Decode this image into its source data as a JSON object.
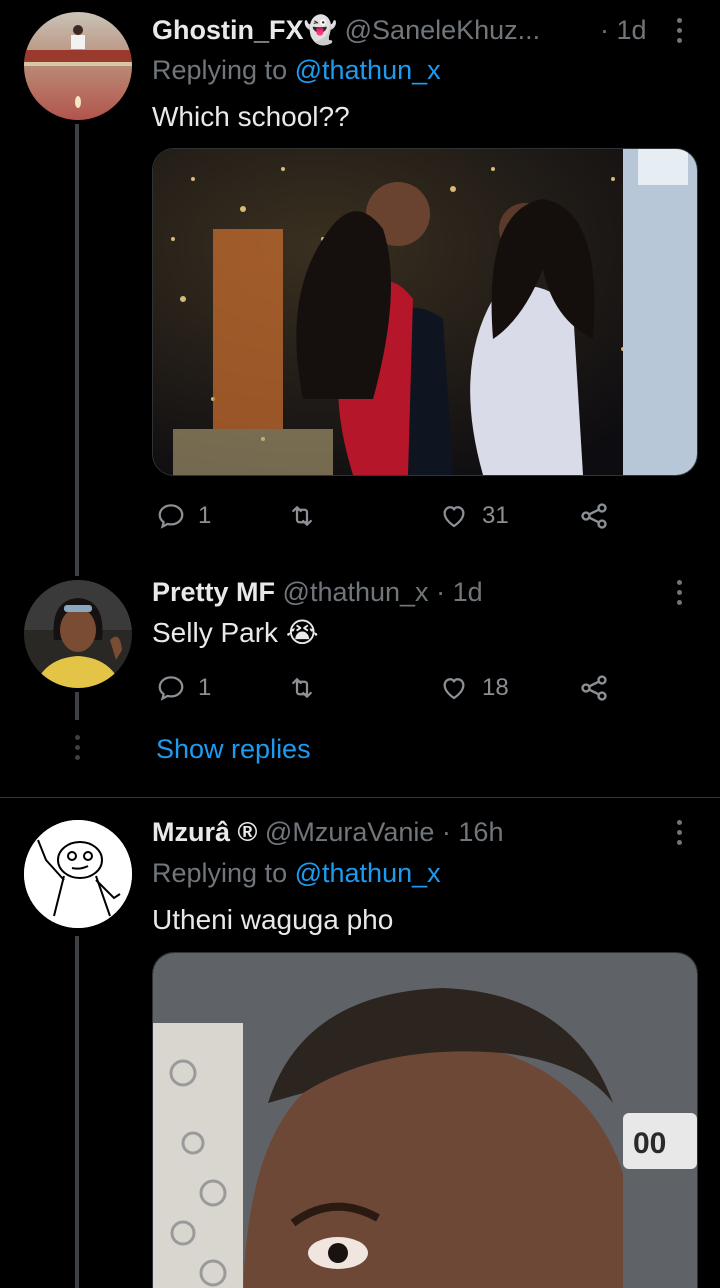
{
  "tweets": [
    {
      "name": "Ghostin_FX👻",
      "handle": "@SaneleKhuz...",
      "time": "· 1d",
      "replying_label": "Replying to",
      "replying_to": "@thathun_x",
      "text": "Which school??",
      "media_icon": "photo-group-hug",
      "counts": {
        "replies": "1",
        "retweets": "",
        "likes": "31"
      }
    },
    {
      "name": "Pretty MF",
      "handle": "@thathun_x",
      "time": "· 1d",
      "text": "Selly Park 😭",
      "counts": {
        "replies": "1",
        "retweets": "",
        "likes": "18"
      }
    },
    {
      "show_replies": "Show replies"
    },
    {
      "name": "Mzurâ ®",
      "handle": "@MzuraVanie",
      "time": "· 16h",
      "replying_label": "Replying to",
      "replying_to": "@thathun_x",
      "text": "Utheni waguga pho",
      "media_icon": "photo-man-frown",
      "media_text": "00"
    }
  ],
  "colors": {
    "background": "#000000",
    "text": "#e7e9ea",
    "secondary": "#71767b",
    "accent": "#1d9bf0",
    "divider": "#2f3336"
  },
  "icons": [
    "reply-icon",
    "retweet-icon",
    "like-icon",
    "share-icon",
    "more-icon"
  ]
}
